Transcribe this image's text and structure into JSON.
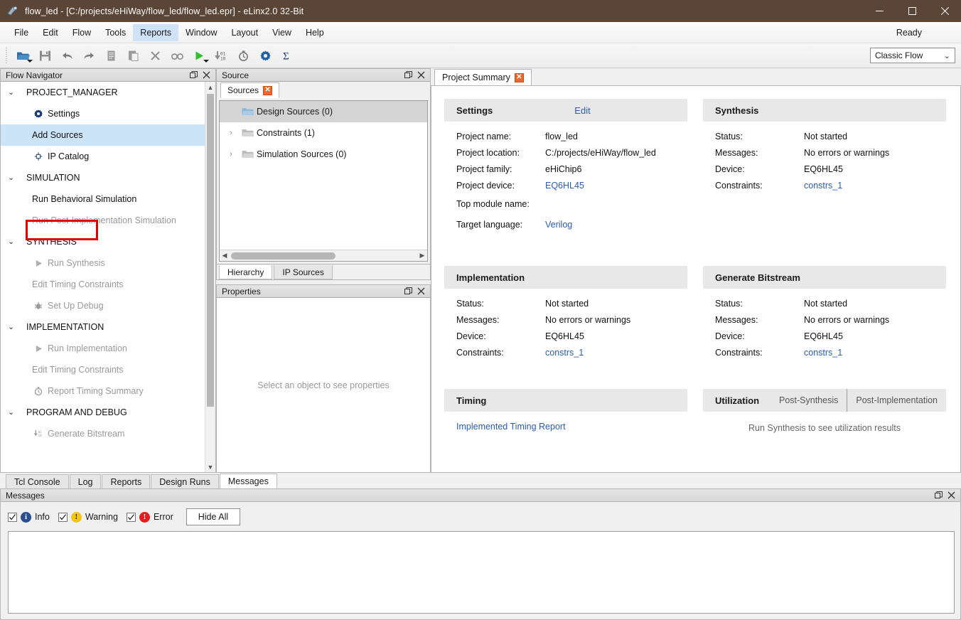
{
  "window": {
    "title": "flow_led - [C:/projects/eHiWay/flow_led/flow_led.epr] - eLinx2.0 32-Bit",
    "app_icon": "app-logo-icon",
    "minimize": "–",
    "maximize": "□",
    "close": "✕",
    "titlebar_color": "#5a4536"
  },
  "menubar": {
    "items": [
      {
        "label": "File",
        "active": false
      },
      {
        "label": "Edit",
        "active": false
      },
      {
        "label": "Flow",
        "active": false
      },
      {
        "label": "Tools",
        "active": false
      },
      {
        "label": "Reports",
        "active": true
      },
      {
        "label": "Window",
        "active": false
      },
      {
        "label": "Layout",
        "active": false
      },
      {
        "label": "View",
        "active": false
      },
      {
        "label": "Help",
        "active": false
      }
    ],
    "status": "Ready",
    "highlight_color": "#cfe2f7"
  },
  "toolbar": {
    "buttons": [
      {
        "name": "open-project-icon",
        "dropdown": true
      },
      {
        "name": "save-icon",
        "dropdown": false
      },
      {
        "name": "undo-icon",
        "dropdown": false
      },
      {
        "name": "redo-icon",
        "dropdown": false
      },
      {
        "name": "copy-icon",
        "dropdown": false
      },
      {
        "name": "paste-icon",
        "dropdown": false
      },
      {
        "name": "delete-icon",
        "dropdown": false
      },
      {
        "name": "find-icon",
        "dropdown": false
      },
      {
        "name": "run-icon",
        "dropdown": true
      },
      {
        "name": "generate-bitstream-icon",
        "dropdown": false
      },
      {
        "name": "timer-icon",
        "dropdown": false
      },
      {
        "name": "settings-gear-icon",
        "dropdown": false
      },
      {
        "name": "sigma-icon",
        "dropdown": false
      }
    ],
    "flow_select": {
      "value": "Classic Flow",
      "chevron": "⌄"
    }
  },
  "flow_navigator": {
    "title": "Flow Navigator",
    "float_icon": "float-icon",
    "close_icon": "close-icon",
    "sections": [
      {
        "label": "PROJECT_MANAGER",
        "chevron": "⌄",
        "items": [
          {
            "label": "Settings",
            "icon": "gear-icon",
            "enabled": true,
            "selected": false
          },
          {
            "label": "Add Sources",
            "icon": "",
            "enabled": true,
            "selected": true
          },
          {
            "label": "IP Catalog",
            "icon": "ip-chip-icon",
            "enabled": true,
            "selected": false
          }
        ]
      },
      {
        "label": "SIMULATION",
        "chevron": "⌄",
        "items": [
          {
            "label": "Run Behavioral Simulation",
            "icon": "",
            "enabled": true,
            "selected": false
          },
          {
            "label": "Run Post-Implementation Simulation",
            "icon": "",
            "enabled": false,
            "selected": false
          }
        ]
      },
      {
        "label": "SYNTHESIS",
        "chevron": "⌄",
        "items": [
          {
            "label": "Run Synthesis",
            "icon": "play-icon",
            "enabled": false,
            "selected": false
          },
          {
            "label": "Edit Timing Constraints",
            "icon": "",
            "enabled": false,
            "selected": false
          },
          {
            "label": "Set Up Debug",
            "icon": "bug-icon",
            "enabled": false,
            "selected": false
          }
        ]
      },
      {
        "label": "IMPLEMENTATION",
        "chevron": "⌄",
        "items": [
          {
            "label": "Run Implementation",
            "icon": "play-icon",
            "enabled": false,
            "selected": false
          },
          {
            "label": "Edit Timing Constraints",
            "icon": "",
            "enabled": false,
            "selected": false
          },
          {
            "label": "Report Timing Summary",
            "icon": "timer-icon",
            "enabled": false,
            "selected": false
          }
        ]
      },
      {
        "label": "PROGRAM AND DEBUG",
        "chevron": "⌄",
        "items": [
          {
            "label": "Generate Bitstream",
            "icon": "bitstream-icon",
            "enabled": false,
            "selected": false
          }
        ]
      }
    ],
    "annotation_color": "#e00000"
  },
  "source_panel": {
    "title": "Source",
    "float_icon": "float-icon",
    "close_icon": "close-icon",
    "tab": {
      "label": "Sources",
      "close": "✕"
    },
    "tree": [
      {
        "label": "Design Sources (0)",
        "chevron": "",
        "icon": "folder-open-icon",
        "selected": true
      },
      {
        "label": "Constraints (1)",
        "chevron": "›",
        "icon": "folder-icon",
        "selected": false
      },
      {
        "label": "Simulation Sources (0)",
        "chevron": "›",
        "icon": "folder-icon",
        "selected": false
      }
    ],
    "bottom_tabs": [
      {
        "label": "Hierarchy",
        "active": true
      },
      {
        "label": "IP Sources",
        "active": false
      }
    ]
  },
  "properties_panel": {
    "title": "Properties",
    "float_icon": "float-icon",
    "close_icon": "close-icon",
    "empty_text": "Select an object to see properties"
  },
  "project_summary": {
    "tab": {
      "label": "Project Summary",
      "close": "✕"
    },
    "settings": {
      "title": "Settings",
      "edit_link": "Edit",
      "rows": [
        {
          "key": "Project name:",
          "value": "flow_led",
          "link": false
        },
        {
          "key": "Project location:",
          "value": "C:/projects/eHiWay/flow_led",
          "link": false
        },
        {
          "key": "Project family:",
          "value": "eHiChip6",
          "link": false
        },
        {
          "key": "Project device:",
          "value": "EQ6HL45",
          "link": true
        },
        {
          "key": "Top module name:",
          "value": "",
          "link": false
        },
        {
          "key": "Target language:",
          "value": "Verilog",
          "link": true
        }
      ]
    },
    "synthesis": {
      "title": "Synthesis",
      "rows": [
        {
          "key": "Status:",
          "value": "Not started",
          "link": false
        },
        {
          "key": "Messages:",
          "value": "No errors or warnings",
          "link": false
        },
        {
          "key": "Device:",
          "value": "EQ6HL45",
          "link": false
        },
        {
          "key": "Constraints:",
          "value": "constrs_1",
          "link": true
        }
      ]
    },
    "implementation": {
      "title": "Implementation",
      "rows": [
        {
          "key": "Status:",
          "value": "Not started",
          "link": false
        },
        {
          "key": "Messages:",
          "value": "No errors or warnings",
          "link": false
        },
        {
          "key": "Device:",
          "value": "EQ6HL45",
          "link": false
        },
        {
          "key": "Constraints:",
          "value": "constrs_1",
          "link": true
        }
      ]
    },
    "bitstream": {
      "title": "Generate Bitstream",
      "rows": [
        {
          "key": "Status:",
          "value": "Not started",
          "link": false
        },
        {
          "key": "Messages:",
          "value": "No errors or warnings",
          "link": false
        },
        {
          "key": "Device:",
          "value": "EQ6HL45",
          "link": false
        },
        {
          "key": "Constraints:",
          "value": "constrs_1",
          "link": true
        }
      ]
    },
    "timing": {
      "title": "Timing",
      "report_link": "Implemented Timing Report"
    },
    "utilization": {
      "title": "Utilization",
      "tabs": [
        "Post-Synthesis",
        "Post-Implementation"
      ],
      "message": "Run Synthesis to see utilization results"
    },
    "link_color": "#2a5db0"
  },
  "bottom_dock": {
    "tabs": [
      {
        "label": "Tcl Console",
        "active": false
      },
      {
        "label": "Log",
        "active": false
      },
      {
        "label": "Reports",
        "active": false
      },
      {
        "label": "Design Runs",
        "active": false
      },
      {
        "label": "Messages",
        "active": true
      }
    ],
    "panel_title": "Messages",
    "float_icon": "float-icon",
    "close_icon": "close-icon",
    "filters": [
      {
        "label": "Info",
        "checked": true,
        "severity": "info",
        "glyph": "i",
        "color": "#2b4d96"
      },
      {
        "label": "Warning",
        "checked": true,
        "severity": "warn",
        "glyph": "!",
        "color": "#f2c518"
      },
      {
        "label": "Error",
        "checked": true,
        "severity": "err",
        "glyph": "!",
        "color": "#e02020"
      }
    ],
    "hide_all_label": "Hide All"
  }
}
